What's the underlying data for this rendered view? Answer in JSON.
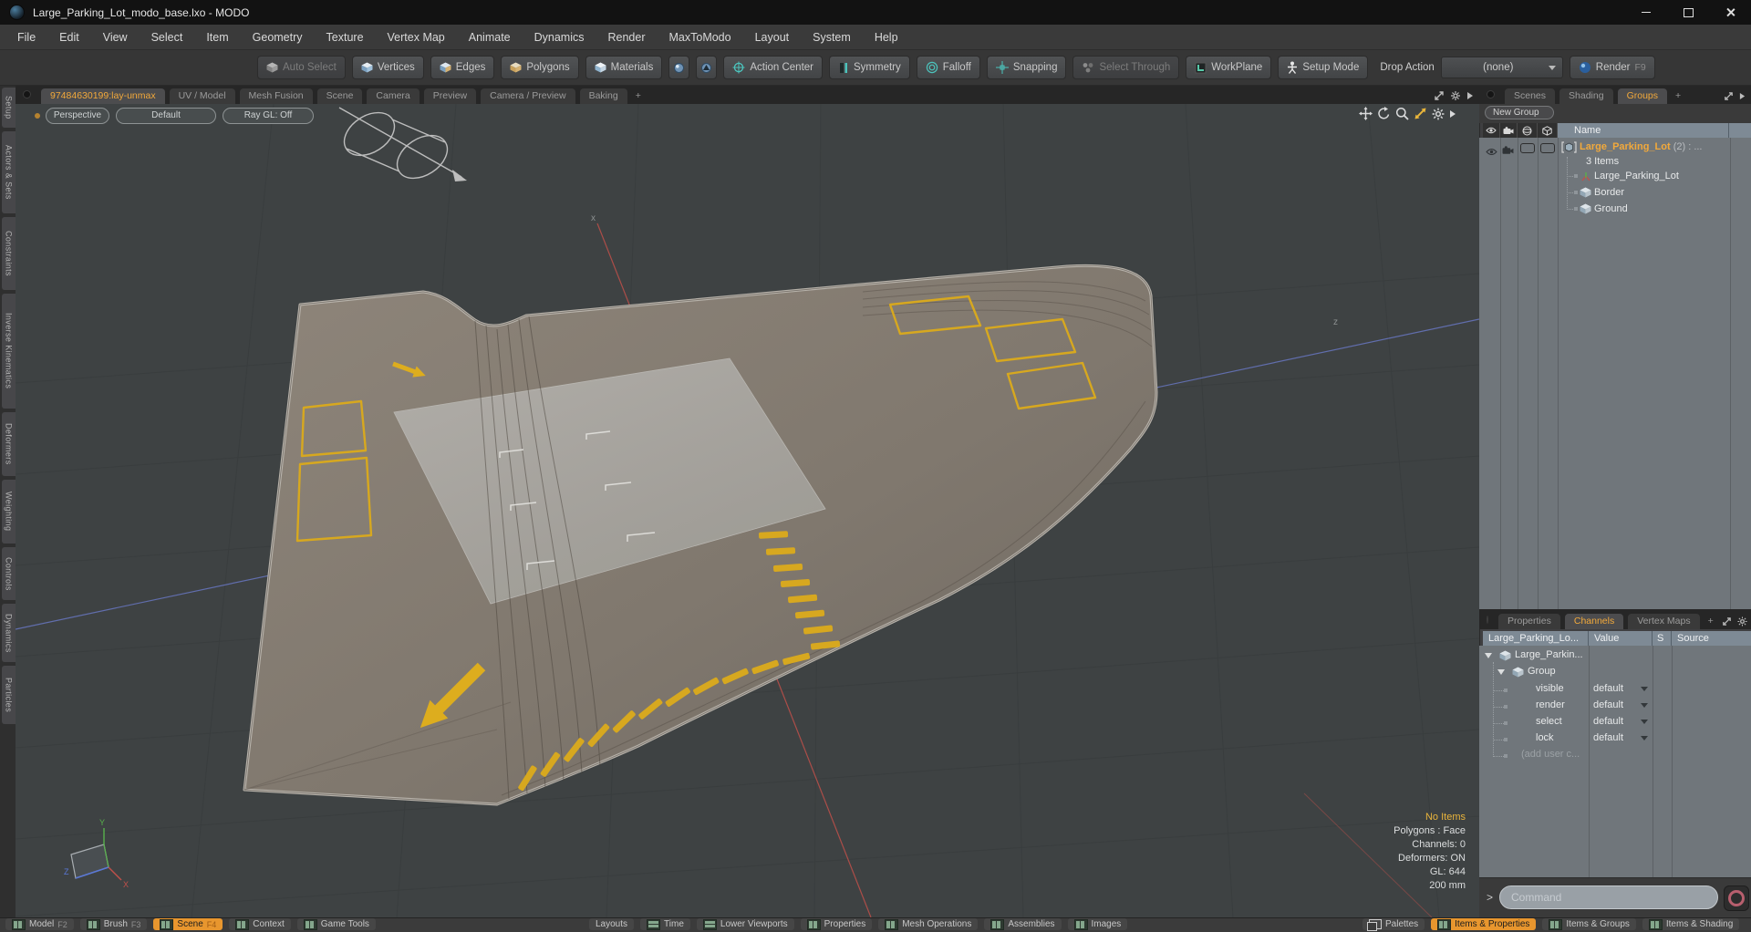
{
  "window": {
    "title": "Large_Parking_Lot_modo_base.lxo - MODO"
  },
  "menu": {
    "items": [
      "File",
      "Edit",
      "View",
      "Select",
      "Item",
      "Geometry",
      "Texture",
      "Vertex Map",
      "Animate",
      "Dynamics",
      "Render",
      "MaxToModo",
      "Layout",
      "System",
      "Help"
    ]
  },
  "toolbar": {
    "auto_select": "Auto Select",
    "vertices": "Vertices",
    "edges": "Edges",
    "polygons": "Polygons",
    "materials": "Materials",
    "action_center": "Action Center",
    "symmetry": "Symmetry",
    "falloff": "Falloff",
    "snapping": "Snapping",
    "select_through": "Select Through",
    "workplane": "WorkPlane",
    "setup_mode": "Setup Mode",
    "drop_action_label": "Drop Action",
    "drop_action_value": "(none)",
    "render_label": "Render",
    "render_key": "F9"
  },
  "doc_tabs": {
    "items": [
      "97484630199:lay-unmax",
      "UV / Model",
      "Mesh Fusion",
      "Scene",
      "Camera",
      "Preview",
      "Camera / Preview",
      "Baking",
      "+"
    ]
  },
  "left_tabs": {
    "items": [
      "Setup",
      "Actors & Sets",
      "Constraints",
      "Inverse Kinematics",
      "Deformers",
      "Weighting",
      "Controls",
      "Dynamics",
      "Particles"
    ]
  },
  "viewport": {
    "perspective": "Perspective",
    "default": "Default",
    "ray_gl": "Ray GL: Off",
    "axis_x": "x",
    "axis_z": "z",
    "gizmo_x": "X",
    "gizmo_y": "Y",
    "gizmo_z": "Z",
    "status": [
      "No Items",
      "Polygons : Face",
      "Channels: 0",
      "Deformers: ON",
      "GL: 644",
      "200 mm"
    ]
  },
  "groups_panel": {
    "tabs": [
      "Scenes",
      "Shading",
      "Groups",
      "+"
    ],
    "new_group": "New Group",
    "name_header": "Name",
    "group_name": "Large_Parking_Lot",
    "group_suffix": "(2) : ...",
    "group_items": "3 Items",
    "children": [
      "Large_Parking_Lot",
      "Border",
      "Ground"
    ]
  },
  "channels_panel": {
    "tabs": [
      "Properties",
      "Channels",
      "Vertex Maps",
      "+"
    ],
    "columns": [
      "Large_Parking_Lo...",
      "Value",
      "S",
      "Source"
    ],
    "root": "Large_Parkin...",
    "group": "Group",
    "rows": [
      {
        "name": "visible",
        "value": "default"
      },
      {
        "name": "render",
        "value": "default"
      },
      {
        "name": "select",
        "value": "default"
      },
      {
        "name": "lock",
        "value": "default"
      }
    ],
    "add_row": "(add user c..."
  },
  "command_bar": {
    "prompt": ">",
    "placeholder": "Command"
  },
  "bottom_bar": {
    "left": [
      {
        "label": "Model",
        "key": "F2"
      },
      {
        "label": "Brush",
        "key": "F3"
      },
      {
        "label": "Scene",
        "key": "F4"
      },
      {
        "label": "Context",
        "key": ""
      },
      {
        "label": "Game Tools",
        "key": ""
      }
    ],
    "middle": [
      "Layouts",
      "Time",
      "Lower Viewports",
      "Properties",
      "Mesh Operations",
      "Assemblies",
      "Images"
    ],
    "right": [
      "Palettes",
      "Items & Properties",
      "Items & Groups",
      "Items & Shading"
    ]
  },
  "colors": {
    "accent_orange": "#f2a93b",
    "active_button_orange": "#e8962e",
    "paint_yellow": "#d7a81f",
    "axis_red": "#c0504a",
    "axis_blue": "#6a79c8"
  }
}
